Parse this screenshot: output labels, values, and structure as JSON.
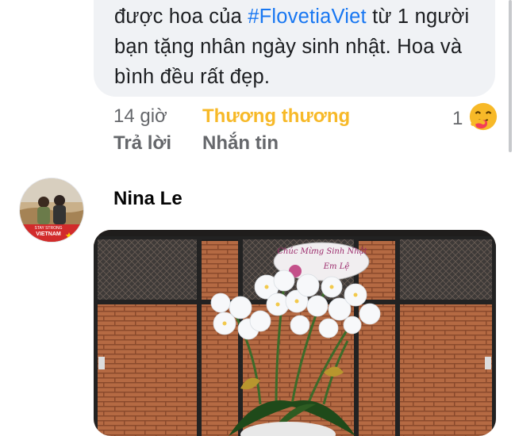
{
  "comment": {
    "text_before": "được hoa của ",
    "hashtag": "#FlovetiaViet",
    "text_after": " từ 1 người bạn tặng nhân ngày sinh nhật. Hoa và bình đều rất đẹp.",
    "time": "14 giờ",
    "reaction_label": "Thương thương",
    "reply_label": "Trả lời",
    "message_label": "Nhắn tin",
    "reaction_count": "1",
    "reaction_icon": "care-reaction-icon"
  },
  "next_comment": {
    "author": "Nina Le",
    "avatar_badge_top": "STAY STRONG",
    "avatar_badge_bottom": "VIETNAM",
    "photo": {
      "sign_line1": "Chúc Mừng Sinh Nhật",
      "sign_line2": "Em Lệ"
    }
  },
  "colors": {
    "bubble": "#f0f2f5",
    "hashtag": "#1877f2",
    "reaction": "#f7b928",
    "secondary_text": "#65676b"
  }
}
